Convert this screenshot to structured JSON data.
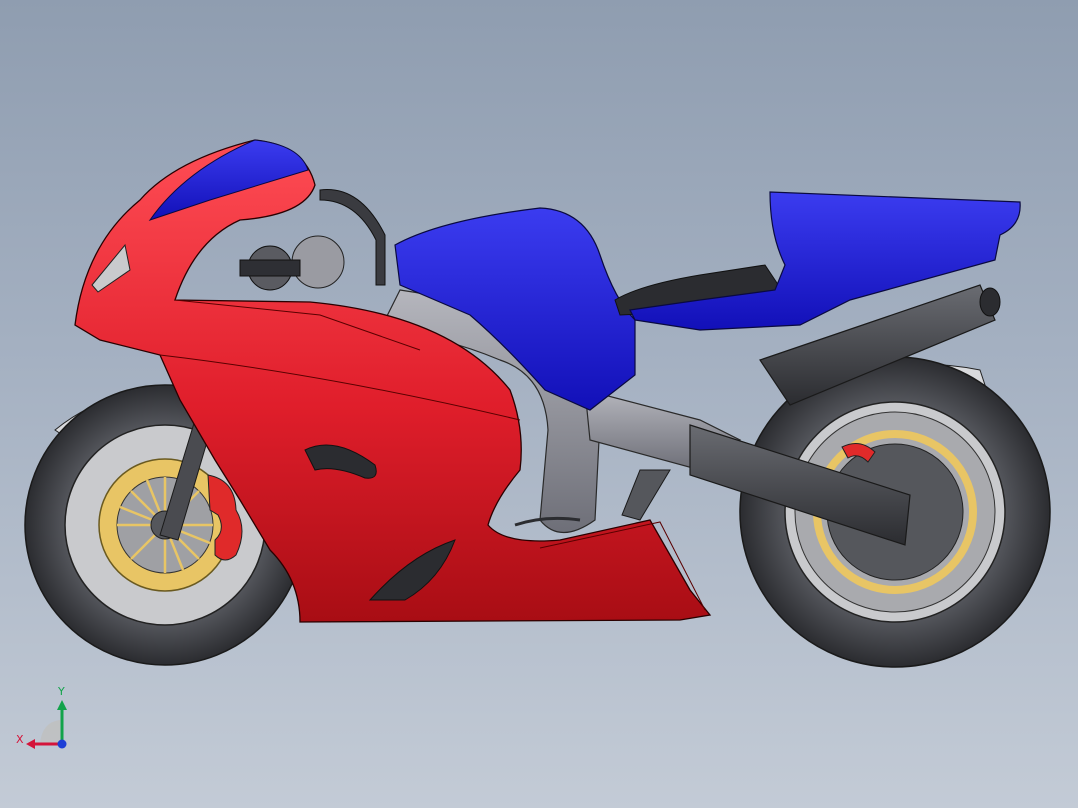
{
  "viewport": {
    "background_top": "#8f9db0",
    "background_bottom": "#c3cbd6"
  },
  "model": {
    "parts": [
      {
        "name": "front-fairing",
        "color": "#e8212d"
      },
      {
        "name": "fuel-tank",
        "color": "#1d1fd6"
      },
      {
        "name": "tail-section",
        "color": "#1d1fd6"
      },
      {
        "name": "frame",
        "color": "#8e8f99"
      },
      {
        "name": "exhaust",
        "color": "#404247"
      },
      {
        "name": "front-wheel",
        "color": "#3a3b40"
      },
      {
        "name": "rear-wheel",
        "color": "#3a3b40"
      },
      {
        "name": "brake-disc",
        "color": "#e8c565"
      },
      {
        "name": "brake-caliper",
        "color": "#e02a2a"
      }
    ]
  },
  "triad": {
    "x_label": "X",
    "y_label": "Y",
    "x_color": "#d4143a",
    "y_color": "#12a34a",
    "z_color": "#1d3fd6"
  }
}
